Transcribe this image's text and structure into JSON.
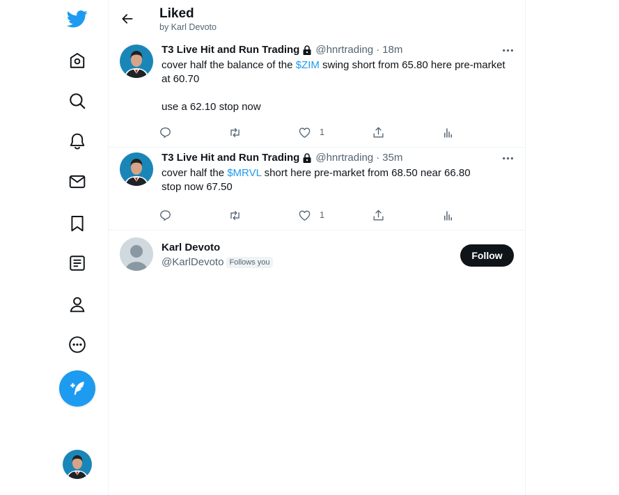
{
  "colors": {
    "accent": "#1d9bf0",
    "text": "#0f1419",
    "muted": "#536471",
    "border": "#eff3f4"
  },
  "sidebar": {
    "items": [
      {
        "icon": "twitter-logo-icon"
      },
      {
        "icon": "home-icon"
      },
      {
        "icon": "explore-search-icon"
      },
      {
        "icon": "notifications-bell-icon"
      },
      {
        "icon": "messages-envelope-icon"
      },
      {
        "icon": "bookmarks-icon"
      },
      {
        "icon": "lists-icon"
      },
      {
        "icon": "profile-icon"
      },
      {
        "icon": "more-circle-icon"
      }
    ],
    "compose_icon": "compose-feather-icon"
  },
  "header": {
    "title": "Liked",
    "subtitle": "by Karl Devoto"
  },
  "tweets": [
    {
      "name": "T3 Live Hit and Run Trading",
      "handle": "@hnrtrading",
      "dot": "·",
      "time": "18m",
      "body_before": "cover half the balance of the ",
      "cashtag": "$ZIM",
      "body_after": " swing short from 65.80 here pre-market at 60.70",
      "body_line2": "use a 62.10 stop now",
      "likes": "1"
    },
    {
      "name": "T3 Live Hit and Run Trading",
      "handle": "@hnrtrading",
      "dot": "·",
      "time": "35m",
      "body_before": "cover half the ",
      "cashtag": "$MRVL",
      "body_after": " short here pre-market from 68.50 near 66.80 stop now 67.50",
      "likes": "1"
    }
  ],
  "user": {
    "name": "Karl Devoto",
    "handle": "@KarlDevoto",
    "badge": "Follows you",
    "follow_label": "Follow"
  }
}
